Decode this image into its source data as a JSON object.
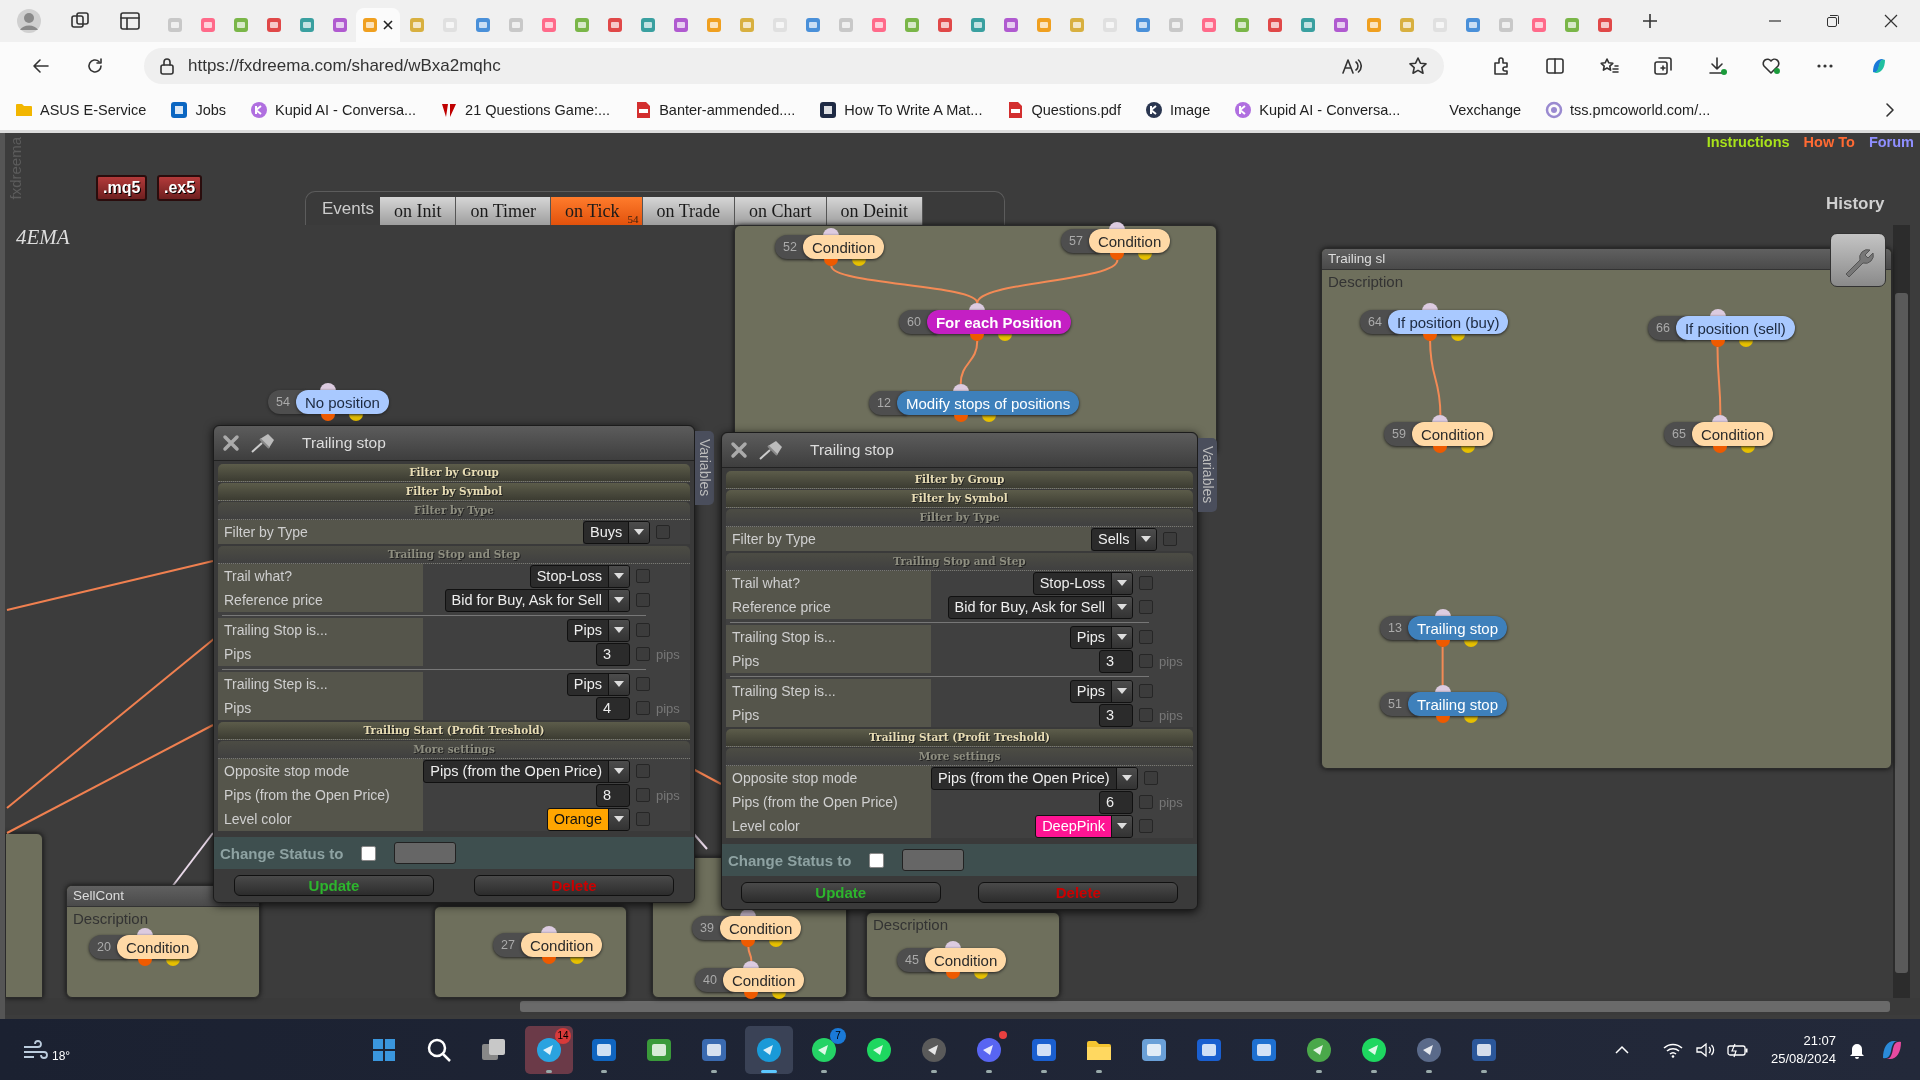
{
  "browser": {
    "tabs": [
      {
        "selected": false
      },
      {
        "selected": false
      },
      {
        "selected": false
      },
      {
        "selected": false
      },
      {
        "selected": false
      },
      {
        "selected": false
      },
      {
        "selected": true
      },
      {
        "selected": false
      },
      {
        "selected": false
      },
      {
        "selected": false
      },
      {
        "selected": false
      },
      {
        "selected": false
      },
      {
        "selected": false
      },
      {
        "selected": false
      },
      {
        "selected": false
      },
      {
        "selected": false
      },
      {
        "selected": false
      },
      {
        "selected": false
      },
      {
        "selected": false
      },
      {
        "selected": false
      },
      {
        "selected": false
      },
      {
        "selected": false
      },
      {
        "selected": false
      },
      {
        "selected": false
      },
      {
        "selected": false
      },
      {
        "selected": false
      },
      {
        "selected": false
      },
      {
        "selected": false
      },
      {
        "selected": false
      },
      {
        "selected": false
      },
      {
        "selected": false
      },
      {
        "selected": false
      },
      {
        "selected": false
      },
      {
        "selected": false
      },
      {
        "selected": false
      },
      {
        "selected": false
      },
      {
        "selected": false
      },
      {
        "selected": false
      },
      {
        "selected": false
      },
      {
        "selected": false
      },
      {
        "selected": false
      },
      {
        "selected": false
      },
      {
        "selected": false
      },
      {
        "selected": false
      }
    ],
    "address": "https://fxdreema.com/shared/wBxa2mqhc",
    "bookmarks": [
      {
        "label": "ASUS E-Service"
      },
      {
        "label": "Jobs"
      },
      {
        "label": "Kupid AI - Conversa..."
      },
      {
        "label": "21 Questions Game:..."
      },
      {
        "label": "Banter-ammended...."
      },
      {
        "label": "How To Write A Mat..."
      },
      {
        "label": "Questions.pdf"
      },
      {
        "label": "Image"
      },
      {
        "label": "Kupid AI - Conversa..."
      },
      {
        "label": "Vexchange"
      },
      {
        "label": "tss.pmcoworld.com/..."
      }
    ]
  },
  "app": {
    "logo": "fxdreema",
    "exports": [
      ".mq5",
      ".ex5"
    ],
    "links": [
      {
        "label": "Instructions",
        "color": "#a8e21a"
      },
      {
        "label": "How To",
        "color": "#ff6a33"
      },
      {
        "label": "Forum",
        "color": "#8f8fff"
      }
    ],
    "history": "History",
    "project": "4EMA",
    "events": {
      "label": "Events",
      "tabs": [
        {
          "label": "on Init",
          "selected": false
        },
        {
          "label": "on Timer",
          "selected": false
        },
        {
          "label": "on Tick",
          "selected": true,
          "badge": "54"
        },
        {
          "label": "on Trade",
          "selected": false
        },
        {
          "label": "on Chart",
          "selected": false
        },
        {
          "label": "on Deinit",
          "selected": false
        }
      ]
    },
    "loose_blocks": [
      {
        "number": "54",
        "label": "No position",
        "kind": "filter"
      }
    ],
    "groups": [
      {
        "blocks": [
          {
            "number": "52",
            "label": "Condition",
            "kind": "condition"
          },
          {
            "number": "57",
            "label": "Condition",
            "kind": "condition"
          },
          {
            "number": "60",
            "label": "For each Position",
            "kind": "loop"
          },
          {
            "number": "12",
            "label": "Modify stops of positions",
            "kind": "action"
          }
        ]
      },
      {
        "title": "Trailing sl",
        "description": "Description",
        "blocks": [
          {
            "number": "64",
            "label": "If position (buy)",
            "kind": "filter"
          },
          {
            "number": "66",
            "label": "If position (sell)",
            "kind": "filter"
          },
          {
            "number": "59",
            "label": "Condition",
            "kind": "condition"
          },
          {
            "number": "65",
            "label": "Condition",
            "kind": "condition"
          },
          {
            "number": "13",
            "label": "Trailing stop",
            "kind": "action"
          },
          {
            "number": "51",
            "label": "Trailing stop",
            "kind": "action"
          }
        ]
      },
      {
        "title": "SellCont",
        "description": "Description",
        "blocks": [
          {
            "number": "20",
            "label": "Condition",
            "kind": "condition"
          }
        ]
      },
      {
        "blocks": [
          {
            "number": "27",
            "label": "Condition",
            "kind": "condition"
          }
        ]
      },
      {
        "blocks": [
          {
            "number": "39",
            "label": "Condition",
            "kind": "condition"
          },
          {
            "number": "40",
            "label": "Condition",
            "kind": "condition"
          }
        ]
      },
      {
        "description": "Description",
        "blocks": [
          {
            "number": "45",
            "label": "Condition",
            "kind": "condition"
          }
        ]
      }
    ],
    "dialogs": [
      {
        "title": "Trailing stop",
        "variables_tab": "Variables",
        "sections": [
          {
            "kind": "header",
            "label": "Filter by Group"
          },
          {
            "kind": "header",
            "label": "Filter by Symbol"
          },
          {
            "kind": "group",
            "label": "Filter by Type",
            "rows": [
              {
                "kind": "select",
                "label": "Filter by Type",
                "value": "Buys",
                "checked": false
              }
            ]
          },
          {
            "kind": "group",
            "label": "Trailing Stop and Step",
            "rows": [
              {
                "kind": "select",
                "label": "Trail what?",
                "value": "Stop-Loss",
                "checked": false
              },
              {
                "kind": "select",
                "label": "Reference price",
                "value": "Bid for Buy, Ask for Sell",
                "checked": false
              },
              {
                "kind": "divider"
              },
              {
                "kind": "select",
                "label": "Trailing Stop is...",
                "value": "Pips",
                "checked": false
              },
              {
                "kind": "number",
                "label": "Pips",
                "value": "3",
                "unit": "pips",
                "checked": false
              },
              {
                "kind": "divider"
              },
              {
                "kind": "select",
                "label": "Trailing Step is...",
                "value": "Pips",
                "checked": false
              },
              {
                "kind": "number",
                "label": "Pips",
                "value": "4",
                "unit": "pips",
                "checked": false
              }
            ]
          },
          {
            "kind": "header",
            "label": "Trailing Start (Profit Treshold)"
          },
          {
            "kind": "group",
            "label": "More settings",
            "rows": [
              {
                "kind": "select",
                "label": "Opposite stop mode",
                "value": "Pips (from the Open Price)",
                "checked": false
              },
              {
                "kind": "number",
                "label": "Pips (from the Open Price)",
                "value": "8",
                "unit": "pips",
                "checked": false
              },
              {
                "kind": "select",
                "label": "Level color",
                "value": "Orange",
                "color": "#ffa500",
                "checked": false
              }
            ]
          }
        ],
        "status": {
          "label": "Change Status to",
          "checked": false
        },
        "buttons": [
          {
            "label": "Update",
            "kind": "update"
          },
          {
            "label": "Delete",
            "kind": "delete"
          }
        ]
      },
      {
        "title": "Trailing stop",
        "variables_tab": "Variables",
        "sections": [
          {
            "kind": "header",
            "label": "Filter by Group"
          },
          {
            "kind": "header",
            "label": "Filter by Symbol"
          },
          {
            "kind": "group",
            "label": "Filter by Type",
            "rows": [
              {
                "kind": "select",
                "label": "Filter by Type",
                "value": "Sells",
                "checked": false
              }
            ]
          },
          {
            "kind": "group",
            "label": "Trailing Stop and Step",
            "rows": [
              {
                "kind": "select",
                "label": "Trail what?",
                "value": "Stop-Loss",
                "checked": false
              },
              {
                "kind": "select",
                "label": "Reference price",
                "value": "Bid for Buy, Ask for Sell",
                "checked": false
              },
              {
                "kind": "divider"
              },
              {
                "kind": "select",
                "label": "Trailing Stop is...",
                "value": "Pips",
                "checked": false
              },
              {
                "kind": "number",
                "label": "Pips",
                "value": "3",
                "unit": "pips",
                "checked": false
              },
              {
                "kind": "divider"
              },
              {
                "kind": "select",
                "label": "Trailing Step is...",
                "value": "Pips",
                "checked": false
              },
              {
                "kind": "number",
                "label": "Pips",
                "value": "3",
                "unit": "pips",
                "checked": false
              }
            ]
          },
          {
            "kind": "header",
            "label": "Trailing Start (Profit Treshold)"
          },
          {
            "kind": "group",
            "label": "More settings",
            "rows": [
              {
                "kind": "select",
                "label": "Opposite stop mode",
                "value": "Pips (from the Open Price)",
                "checked": false
              },
              {
                "kind": "number",
                "label": "Pips (from the Open Price)",
                "value": "6",
                "unit": "pips",
                "checked": false
              },
              {
                "kind": "select",
                "label": "Level color",
                "value": "DeepPink",
                "color": "#ff1493",
                "checked": false
              }
            ]
          }
        ],
        "status": {
          "label": "Change Status to",
          "checked": false
        },
        "buttons": [
          {
            "label": "Update",
            "kind": "update"
          },
          {
            "label": "Delete",
            "kind": "delete"
          }
        ]
      }
    ]
  },
  "taskbar": {
    "weather": "18°",
    "time": "21:07",
    "date": "25/08/2024",
    "apps": [
      {
        "kind": "start",
        "color": "#3a96dd",
        "running": false,
        "active": false,
        "attention": false,
        "notify": false
      },
      {
        "kind": "search",
        "color": "#ffffff",
        "running": false,
        "active": false,
        "attention": false,
        "notify": false
      },
      {
        "kind": "taskview",
        "color": "#c8c8c8",
        "running": false,
        "active": false,
        "attention": false,
        "notify": false
      },
      {
        "kind": "circle",
        "color": "#2aa3e0",
        "running": true,
        "active": false,
        "attention": true,
        "notify": false,
        "badge": "14"
      },
      {
        "kind": "square",
        "color": "#1065c0",
        "running": true,
        "active": false,
        "attention": false,
        "notify": false
      },
      {
        "kind": "square",
        "color": "#3a9a3a",
        "running": false,
        "active": false,
        "attention": false,
        "notify": false
      },
      {
        "kind": "square",
        "color": "#3a6ab0",
        "running": true,
        "active": false,
        "attention": false,
        "notify": false
      },
      {
        "kind": "circle",
        "color": "#1a9ad8",
        "running": true,
        "active": true,
        "attention": false,
        "notify": false
      },
      {
        "kind": "circle",
        "color": "#25d366",
        "running": true,
        "active": false,
        "attention": false,
        "notify": false,
        "badge": "7"
      },
      {
        "kind": "circle",
        "color": "#1ed760",
        "running": false,
        "active": false,
        "attention": false,
        "notify": false
      },
      {
        "kind": "circle",
        "color": "#5a5a5a",
        "running": true,
        "active": false,
        "attention": false,
        "notify": false
      },
      {
        "kind": "circle",
        "color": "#5865f2",
        "running": true,
        "active": false,
        "attention": false,
        "notify": true
      },
      {
        "kind": "square",
        "color": "#1a5fd0",
        "running": true,
        "active": false,
        "attention": false,
        "notify": false
      },
      {
        "kind": "folder",
        "color": "#f4c430",
        "running": true,
        "active": false,
        "attention": false,
        "notify": false
      },
      {
        "kind": "square",
        "color": "#6aa0d8",
        "running": false,
        "active": false,
        "attention": false,
        "notify": false
      },
      {
        "kind": "square",
        "color": "#1a5fd0",
        "running": false,
        "active": false,
        "attention": false,
        "notify": false
      },
      {
        "kind": "square",
        "color": "#1e70d0",
        "running": false,
        "active": false,
        "attention": false,
        "notify": false
      },
      {
        "kind": "circle",
        "color": "#4aa84a",
        "running": true,
        "active": false,
        "attention": false,
        "notify": false
      },
      {
        "kind": "circle",
        "color": "#1ed760",
        "running": true,
        "active": false,
        "attention": false,
        "notify": false
      },
      {
        "kind": "circle",
        "color": "#5a6a8a",
        "running": true,
        "active": false,
        "attention": false,
        "notify": false
      },
      {
        "kind": "square",
        "color": "#2b579a",
        "running": true,
        "active": false,
        "attention": false,
        "notify": false
      }
    ]
  }
}
